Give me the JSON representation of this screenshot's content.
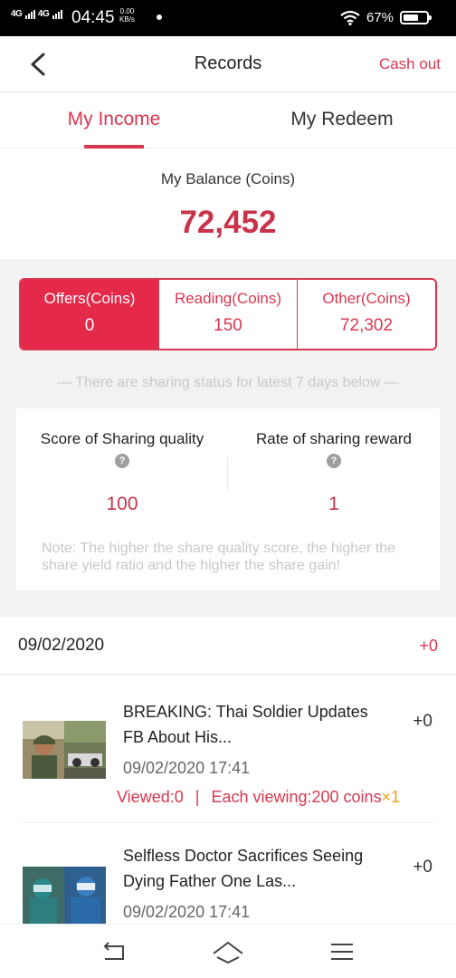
{
  "status_bar": {
    "network_1": "4G",
    "network_2": "4G",
    "time": "04:45",
    "speed_value": "0.00",
    "speed_unit": "KB/s",
    "battery": "67%"
  },
  "header": {
    "title": "Records",
    "cash_out": "Cash out"
  },
  "tabs": [
    {
      "label": "My Income",
      "active": true
    },
    {
      "label": "My Redeem",
      "active": false
    }
  ],
  "balance": {
    "label": "My Balance (Coins)",
    "value": "72,452"
  },
  "coins": [
    {
      "label": "Offers(Coins)",
      "value": "0",
      "active": true
    },
    {
      "label": "Reading(Coins)",
      "value": "150",
      "active": false
    },
    {
      "label": "Other(Coins)",
      "value": "72,302",
      "active": false
    }
  ],
  "sharing_hint": "— There are sharing status for latest 7 days below —",
  "sharing": {
    "quality_label": "Score of Sharing quality",
    "quality_value": "100",
    "reward_label": "Rate of sharing reward",
    "reward_value": "1",
    "help_glyph": "?",
    "note": "Note: The higher the share quality score, the higher the share yield ratio and the higher the share gain!"
  },
  "date_group": {
    "date": "09/02/2020",
    "delta": "+0"
  },
  "items": [
    {
      "title": "BREAKING: Thai Soldier Updates FB About His...",
      "delta": "+0",
      "time": "09/02/2020 17:41",
      "viewed": "Viewed:0",
      "separator": "|",
      "each_viewing": "Each viewing:200 coins",
      "multiplier": "×1"
    },
    {
      "title": "Selfless Doctor Sacrifices Seeing Dying Father One Las...",
      "delta": "+0",
      "time": "09/02/2020 17:41"
    }
  ],
  "colors": {
    "accent": "#d9374f",
    "accent_fill": "#e4294a",
    "multiplier": "#f0a020"
  },
  "icons": {
    "back": "chevron-left-icon",
    "help": "question-mark-icon",
    "nav_back": "back-arrow-icon",
    "nav_home": "home-icon",
    "nav_menu": "menu-icon"
  }
}
